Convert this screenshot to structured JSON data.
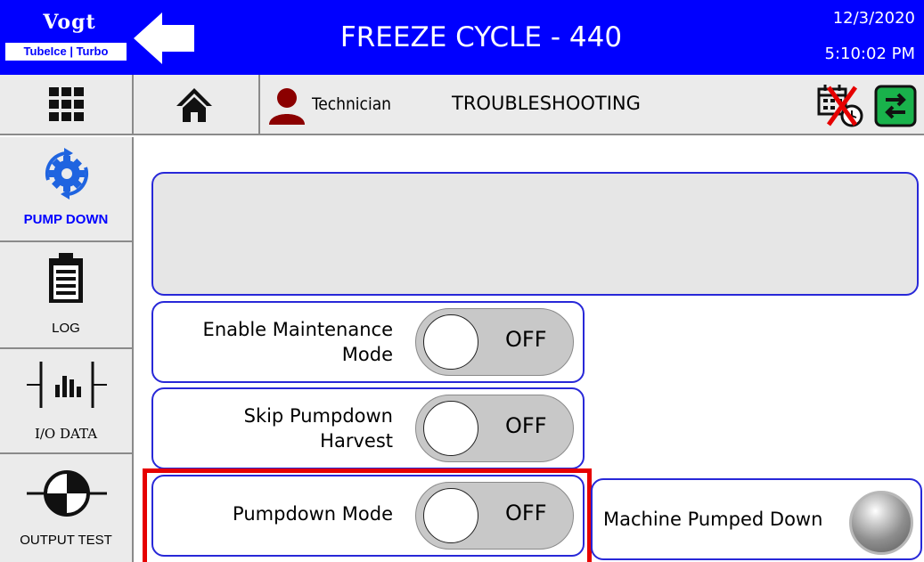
{
  "header": {
    "logo_top": "Vogt",
    "logo_bottom": "TubeIce | Turbo",
    "title": "FREEZE CYCLE - 440",
    "date": "12/3/2020",
    "time": "5:10:02 PM",
    "color": "#0000ff"
  },
  "toolbar": {
    "user": "Technician",
    "section": "TROUBLESHOOTING"
  },
  "sidenav": {
    "items": [
      {
        "label": "PUMP DOWN",
        "icon": "gear-cycle-icon",
        "active": true
      },
      {
        "label": "LOG",
        "icon": "clipboard-icon"
      },
      {
        "label": "I/O DATA",
        "icon": "io-bars-icon"
      },
      {
        "label": "OUTPUT TEST",
        "icon": "output-target-icon"
      }
    ]
  },
  "toggles": [
    {
      "label_line1": "Enable Maintenance",
      "label_line2": "Mode",
      "state": "OFF"
    },
    {
      "label_line1": "Skip Pumpdown",
      "label_line2": "Harvest",
      "state": "OFF"
    },
    {
      "label_line1": "Pumpdown Mode",
      "label_line2": "",
      "state": "OFF"
    }
  ],
  "status": {
    "label": "Machine Pumped Down"
  },
  "colors": {
    "accent": "#0000ff",
    "panel_border": "#2828d8",
    "highlight": "#e60000",
    "user_icon": "#8b0000",
    "swap_icon": "#19b24b"
  }
}
